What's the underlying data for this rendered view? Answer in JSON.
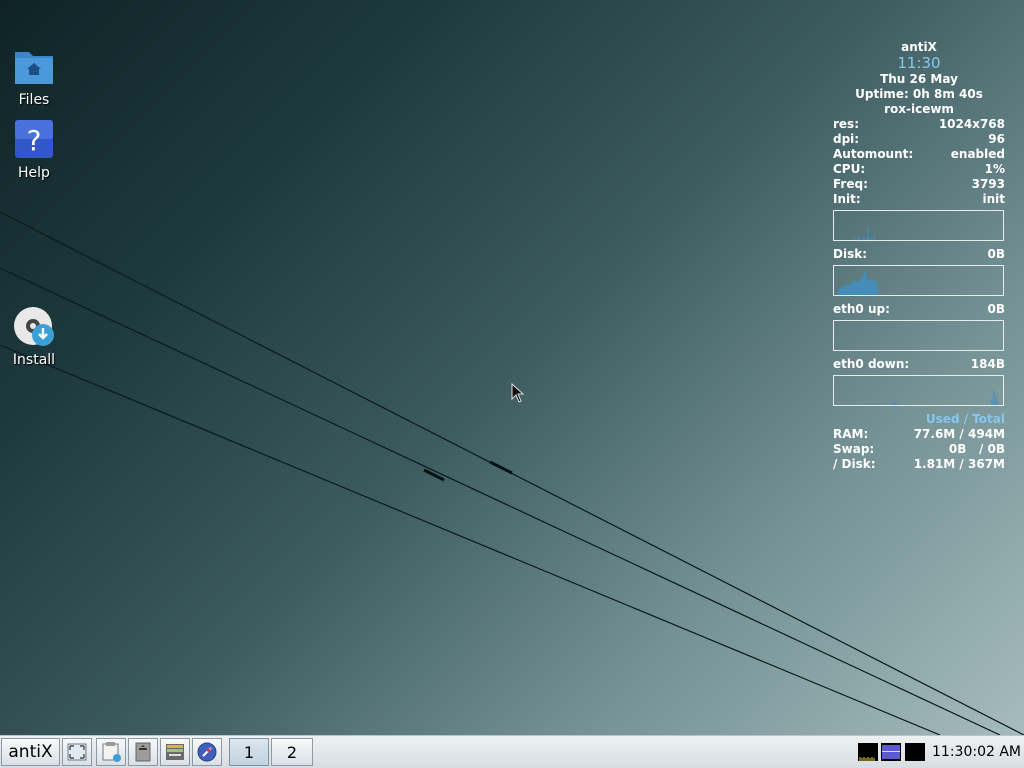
{
  "desktop": {
    "icons": [
      {
        "label": "Files"
      },
      {
        "label": "Help"
      },
      {
        "label": "Install"
      }
    ]
  },
  "conky": {
    "hostname": "antiX",
    "time": "11:30",
    "date": "Thu 26 May",
    "uptime": "Uptime: 0h 8m 40s",
    "session": "rox-icewm",
    "stats": [
      {
        "key": "res:",
        "value": "1024x768"
      },
      {
        "key": "dpi:",
        "value": "96"
      },
      {
        "key": "Automount:",
        "value": "enabled"
      },
      {
        "key": "CPU:",
        "value": "1%"
      },
      {
        "key": "Freq:",
        "value": "3793"
      },
      {
        "key": "Init:",
        "value": "init"
      }
    ],
    "disk": {
      "key": "Disk:",
      "value": "0B"
    },
    "eth_up": {
      "key": "eth0 up:",
      "value": "0B"
    },
    "eth_down": {
      "key": "eth0 down:",
      "value": "184B"
    },
    "mem_header": "Used / Total",
    "mem": [
      {
        "key": "RAM:",
        "used": "77.6M",
        "total": "494M"
      },
      {
        "key": "Swap:",
        "used": "0B",
        "total": "0B"
      },
      {
        "key": "/ Disk:",
        "used": "1.81M",
        "total": "367M"
      }
    ],
    "graph_color": "#3f8fc6"
  },
  "taskbar": {
    "start_label": "antiX",
    "quicklaunch": [
      {
        "icon": "show-desktop-icon"
      },
      {
        "icon": "file-manager-icon"
      },
      {
        "icon": "terminal-icon"
      },
      {
        "icon": "file-cabinet-icon"
      },
      {
        "icon": "web-browser-icon"
      }
    ],
    "workspaces": [
      "1",
      "2"
    ],
    "clock": "11:30:02 AM"
  }
}
